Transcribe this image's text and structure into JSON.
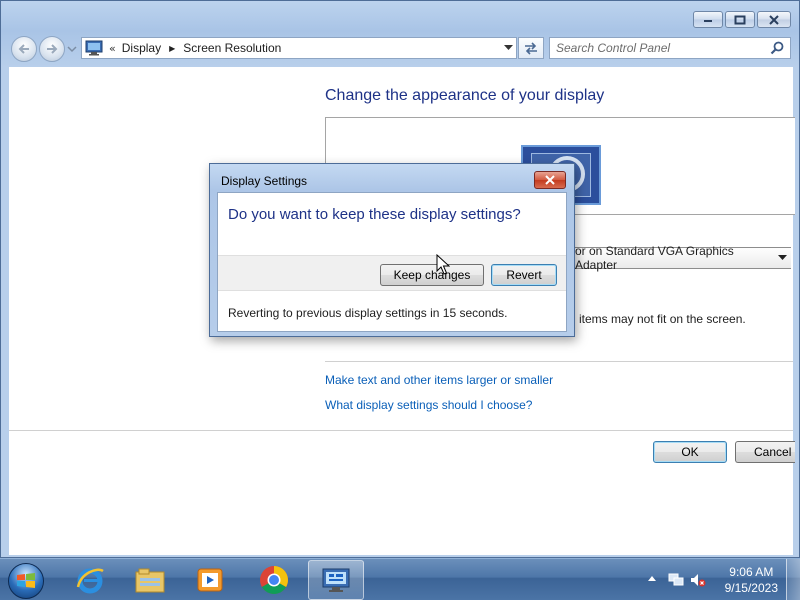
{
  "window": {
    "breadcrumb": [
      "Display",
      "Screen Resolution"
    ],
    "breadcrumb_prefix": "«"
  },
  "search": {
    "placeholder": "Search Control Panel"
  },
  "main": {
    "title": "Change the appearance of your display",
    "display_select_value": "or on Standard VGA Graphics Adapter",
    "partial_text": "items may not fit on the screen.",
    "links": [
      "Make text and other items larger or smaller",
      "What display settings should I choose?"
    ],
    "ok_label": "OK",
    "cancel_label": "Cancel"
  },
  "dialog": {
    "title": "Display Settings",
    "question": "Do you want to keep these display settings?",
    "keep_label": "Keep changes",
    "revert_label": "Revert",
    "status": "Reverting to previous display settings in 15 seconds."
  },
  "taskbar": {
    "items": [
      "internet-explorer",
      "windows-explorer",
      "media-player",
      "chrome",
      "control-panel"
    ],
    "active_item": "control-panel",
    "clock_time": "9:06 AM",
    "clock_date": "9/15/2023"
  },
  "colors": {
    "title_blue": "#1e3287",
    "link_blue": "#0a5fb8",
    "window_frame": "#a9c4e6"
  }
}
